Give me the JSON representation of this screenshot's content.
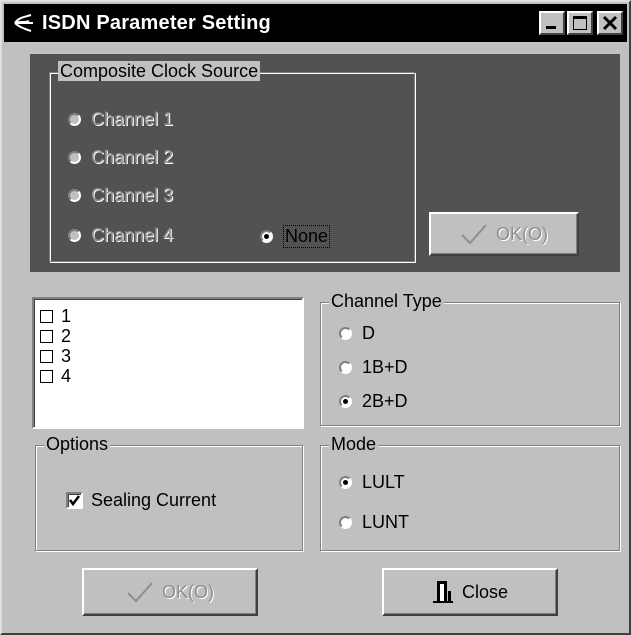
{
  "window": {
    "title": "ISDN Parameter Setting"
  },
  "clock_source": {
    "legend": "Composite Clock Source",
    "options": [
      {
        "label": "Channel 1",
        "selected": false,
        "enabled": false
      },
      {
        "label": "Channel 2",
        "selected": false,
        "enabled": false
      },
      {
        "label": "Channel 3",
        "selected": false,
        "enabled": false
      },
      {
        "label": "Channel 4",
        "selected": false,
        "enabled": false
      },
      {
        "label": "None",
        "selected": true,
        "enabled": true
      }
    ],
    "ok_button": "OK(O)"
  },
  "channels": {
    "items": [
      {
        "label": "1",
        "checked": false
      },
      {
        "label": "2",
        "checked": false
      },
      {
        "label": "3",
        "checked": false
      },
      {
        "label": "4",
        "checked": false
      }
    ]
  },
  "channel_type": {
    "legend": "Channel Type",
    "options": [
      {
        "label": "D",
        "selected": false
      },
      {
        "label": "1B+D",
        "selected": false
      },
      {
        "label": "2B+D",
        "selected": true
      }
    ]
  },
  "options": {
    "legend": "Options",
    "sealing_current": {
      "label": "Sealing Current",
      "checked": true
    }
  },
  "mode": {
    "legend": "Mode",
    "options": [
      {
        "label": "LULT",
        "selected": true
      },
      {
        "label": "LUNT",
        "selected": false
      }
    ]
  },
  "footer": {
    "ok_button": "OK(O)",
    "close_button": "Close"
  }
}
